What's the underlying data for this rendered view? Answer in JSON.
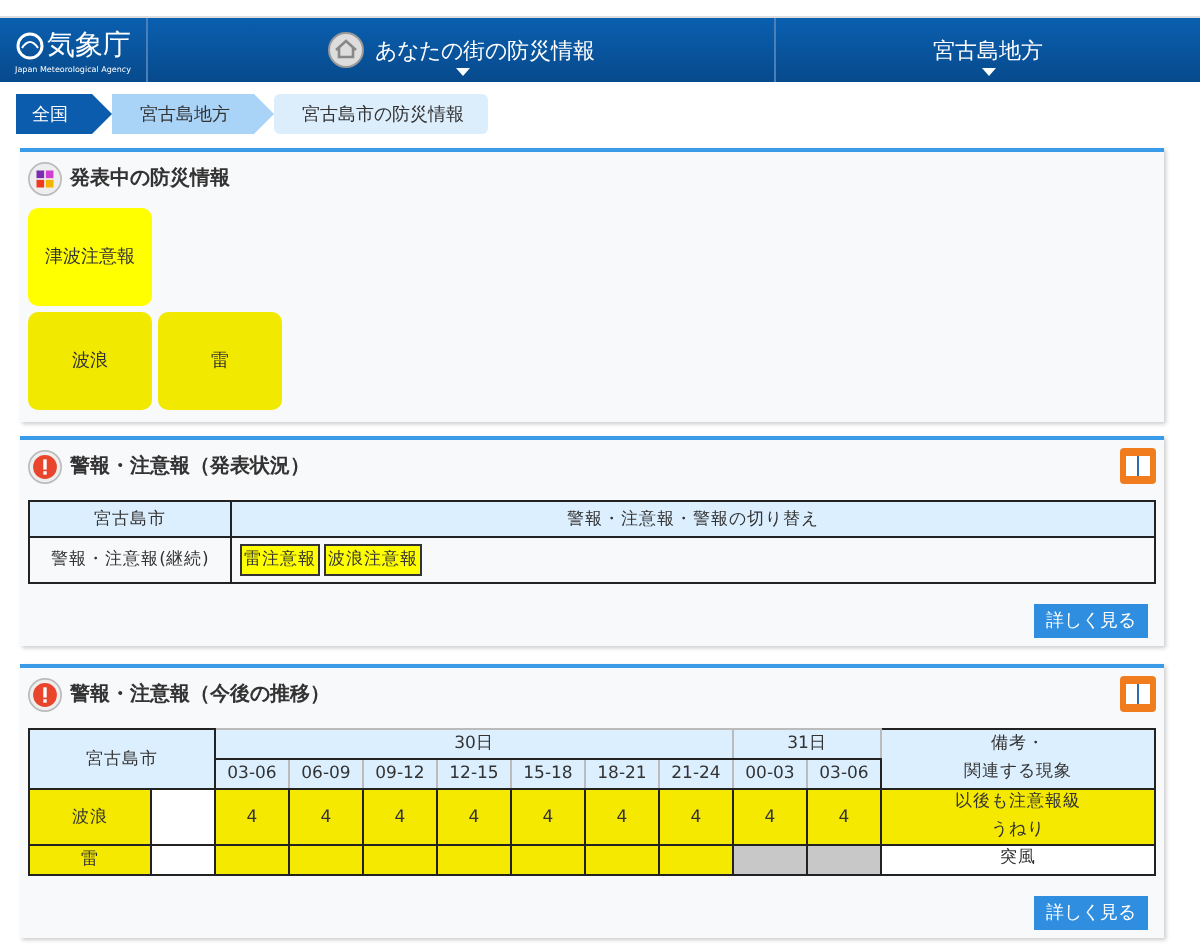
{
  "header": {
    "logo": "気象庁",
    "logo_sub": "Japan Meteorological Agency",
    "nav": [
      {
        "label": "あなたの街の防災情報",
        "kind": "home"
      },
      {
        "label": "宮古島地方",
        "kind": "plain"
      }
    ]
  },
  "breadcrumb": [
    {
      "label": "全国",
      "color": "#0b5cad"
    },
    {
      "label": "宮古島地方",
      "color": "#a9d3f7"
    },
    {
      "label": "宮古島市の防災情報",
      "color": "#dcedfc"
    }
  ],
  "current": {
    "title": "発表中の防災情報",
    "tiles": [
      [
        {
          "label": "津波注意報",
          "color": "#ffff00"
        }
      ],
      [
        {
          "label": "波浪",
          "color": "#f2e900"
        },
        {
          "label": "雷",
          "color": "#f2e900"
        }
      ]
    ]
  },
  "status": {
    "title": "警報・注意報（発表状況）",
    "columns": [
      "宮古島市",
      "警報・注意報・警報の切り替え"
    ],
    "row_label": "警報・注意報(継続)",
    "badges": [
      "雷注意報",
      "波浪注意報"
    ],
    "more": "詳しく見る"
  },
  "forecast": {
    "title": "警報・注意報（今後の推移）",
    "area": "宮古島市",
    "days": [
      {
        "label": "30日",
        "times": [
          "03-06",
          "06-09",
          "09-12",
          "12-15",
          "15-18",
          "18-21",
          "21-24"
        ]
      },
      {
        "label": "31日",
        "times": [
          "00-03",
          "03-06"
        ]
      }
    ],
    "remarks_header": [
      "備考・",
      "関連する現象"
    ],
    "rows": [
      {
        "name": "波浪",
        "color": "#f5e900",
        "cells": [
          {
            "value": "4",
            "color": "#f5e900"
          },
          {
            "value": "4",
            "color": "#f5e900"
          },
          {
            "value": "4",
            "color": "#f5e900"
          },
          {
            "value": "4",
            "color": "#f5e900"
          },
          {
            "value": "4",
            "color": "#f5e900"
          },
          {
            "value": "4",
            "color": "#f5e900"
          },
          {
            "value": "4",
            "color": "#f5e900"
          },
          {
            "value": "4",
            "color": "#f5e900"
          },
          {
            "value": "4",
            "color": "#f5e900"
          }
        ],
        "remarks": {
          "lines": [
            "以後も注意報級",
            "うねり"
          ],
          "color": "#f5e900"
        }
      },
      {
        "name": "雷",
        "color": "#f5e900",
        "cells": [
          {
            "color": "#f5e900"
          },
          {
            "color": "#f5e900"
          },
          {
            "color": "#f5e900"
          },
          {
            "color": "#f5e900"
          },
          {
            "color": "#f5e900"
          },
          {
            "color": "#f5e900"
          },
          {
            "color": "#f5e900"
          },
          {
            "color": "#c8c8c8"
          },
          {
            "color": "#c8c8c8"
          }
        ],
        "remarks": {
          "lines": [
            "突風"
          ],
          "color": "#ffffff"
        }
      }
    ],
    "more": "詳しく見る"
  }
}
